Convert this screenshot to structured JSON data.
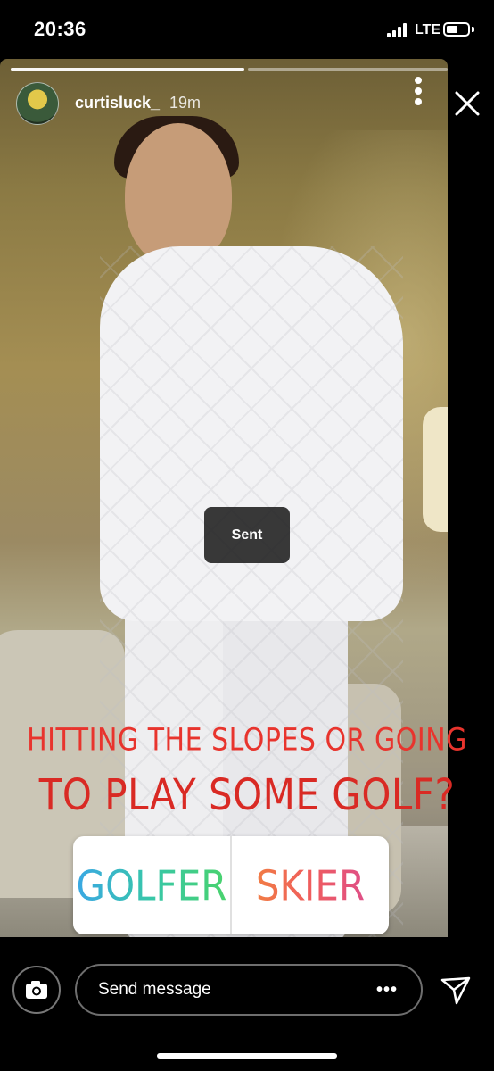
{
  "status_bar": {
    "time": "20:36",
    "network": "LTE"
  },
  "story": {
    "username": "curtisluck_",
    "time_ago": "19m",
    "question_line1": "HITTING THE SLOPES OR GOING",
    "question_line2": "TO PLAY SOME GOLF?",
    "poll": {
      "option_left": "GOLFER",
      "option_right": "SKIER"
    },
    "toast": "Sent",
    "progress_segments": 2,
    "active_segment": 1
  },
  "bottom_bar": {
    "message_placeholder": "Send message",
    "more_label": "•••"
  },
  "icons": {
    "camera": "camera-icon",
    "send": "paper-plane-icon",
    "close": "close-icon",
    "more": "more-vertical-icon"
  },
  "colors": {
    "question_text": "#e8342d",
    "golfer_gradient": [
      "#3aa6e6",
      "#4ad36b"
    ],
    "skier_gradient": [
      "#f28a3a",
      "#d94a9a"
    ]
  }
}
